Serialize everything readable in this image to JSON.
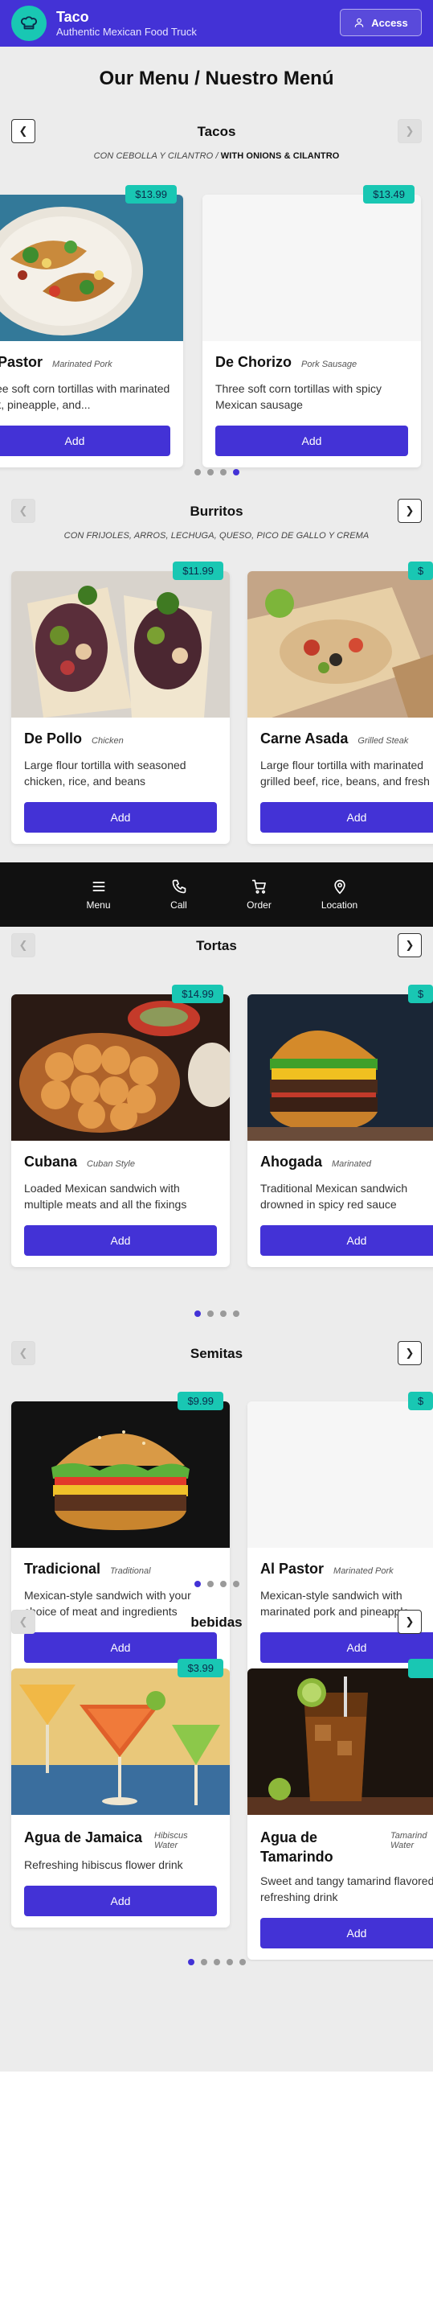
{
  "header": {
    "title": "Taco",
    "subtitle": "Authentic Mexican Food Truck",
    "access_label": "Access"
  },
  "page_title": "Our Menu / Nuestro Menú",
  "sections": {
    "tacos": {
      "title": "Tacos",
      "sub_normal": "CON CEBOLLA Y CILANTRO / ",
      "sub_bold": "WITH ONIONS & CILANTRO",
      "items": [
        {
          "price": "$13.99",
          "name": "Al Pastor",
          "tag": "Marinated Pork",
          "desc": "Three soft corn tortillas with marinated pork, pineapple, and...",
          "add": "Add"
        },
        {
          "price": "$13.49",
          "name": "De Chorizo",
          "tag": "Pork Sausage",
          "desc": "Three soft corn tortillas with spicy Mexican sausage",
          "add": "Add"
        }
      ]
    },
    "burritos": {
      "title": "Burritos",
      "sub": "CON FRIJOLES, ARROS, LECHUGA, QUESO, PICO DE GALLO Y CREMA",
      "items": [
        {
          "price": "$11.99",
          "name": "De Pollo",
          "tag": "Chicken",
          "desc": "Large flour tortilla with seasoned chicken, rice, and beans",
          "add": "Add"
        },
        {
          "price": "$",
          "name": "Carne Asada",
          "tag": "Grilled Steak",
          "desc": "Large flour tortilla with marinated grilled beef, rice, beans, and fresh",
          "add": "Add"
        }
      ]
    },
    "tortas": {
      "title": "Tortas",
      "items": [
        {
          "price": "$14.99",
          "name": "Cubana",
          "tag": "Cuban Style",
          "desc": "Loaded Mexican sandwich with multiple meats and all the fixings",
          "add": "Add"
        },
        {
          "price": "$",
          "name": "Ahogada",
          "tag": "Marinated",
          "desc": "Traditional Mexican sandwich drowned in spicy red sauce",
          "add": "Add"
        }
      ]
    },
    "semitas": {
      "title": "Semitas",
      "items": [
        {
          "price": "$9.99",
          "name": "Tradicional",
          "tag": "Traditional",
          "desc": "Mexican-style sandwich with your choice of meat and ingredients",
          "add": "Add"
        },
        {
          "price": "$",
          "name": "Al Pastor",
          "tag": "Marinated Pork",
          "desc": "Mexican-style sandwich with marinated pork and pineapple",
          "add": "Add"
        }
      ]
    },
    "bebidas": {
      "title": "bebidas",
      "items": [
        {
          "price": "$3.99",
          "name": "Agua de Jamaica",
          "tag": "Hibiscus Water",
          "desc": "Refreshing hibiscus flower drink",
          "add": "Add"
        },
        {
          "price": "",
          "name": "Agua de Tamarindo",
          "tag": "Tamarind Water",
          "desc": "Sweet and tangy tamarind flavored refreshing drink",
          "add": "Add"
        }
      ]
    }
  },
  "bottom_nav": {
    "menu": "Menu",
    "call": "Call",
    "order": "Order",
    "location": "Location"
  },
  "colors": {
    "primary": "#4332d6",
    "accent": "#19c7b3",
    "background": "#ececec",
    "nav": "#111111"
  },
  "icons": [
    "chef-hat-icon",
    "user-icon",
    "chevron-left-icon",
    "chevron-right-icon",
    "menu-icon",
    "phone-icon",
    "cart-icon",
    "location-pin-icon"
  ]
}
